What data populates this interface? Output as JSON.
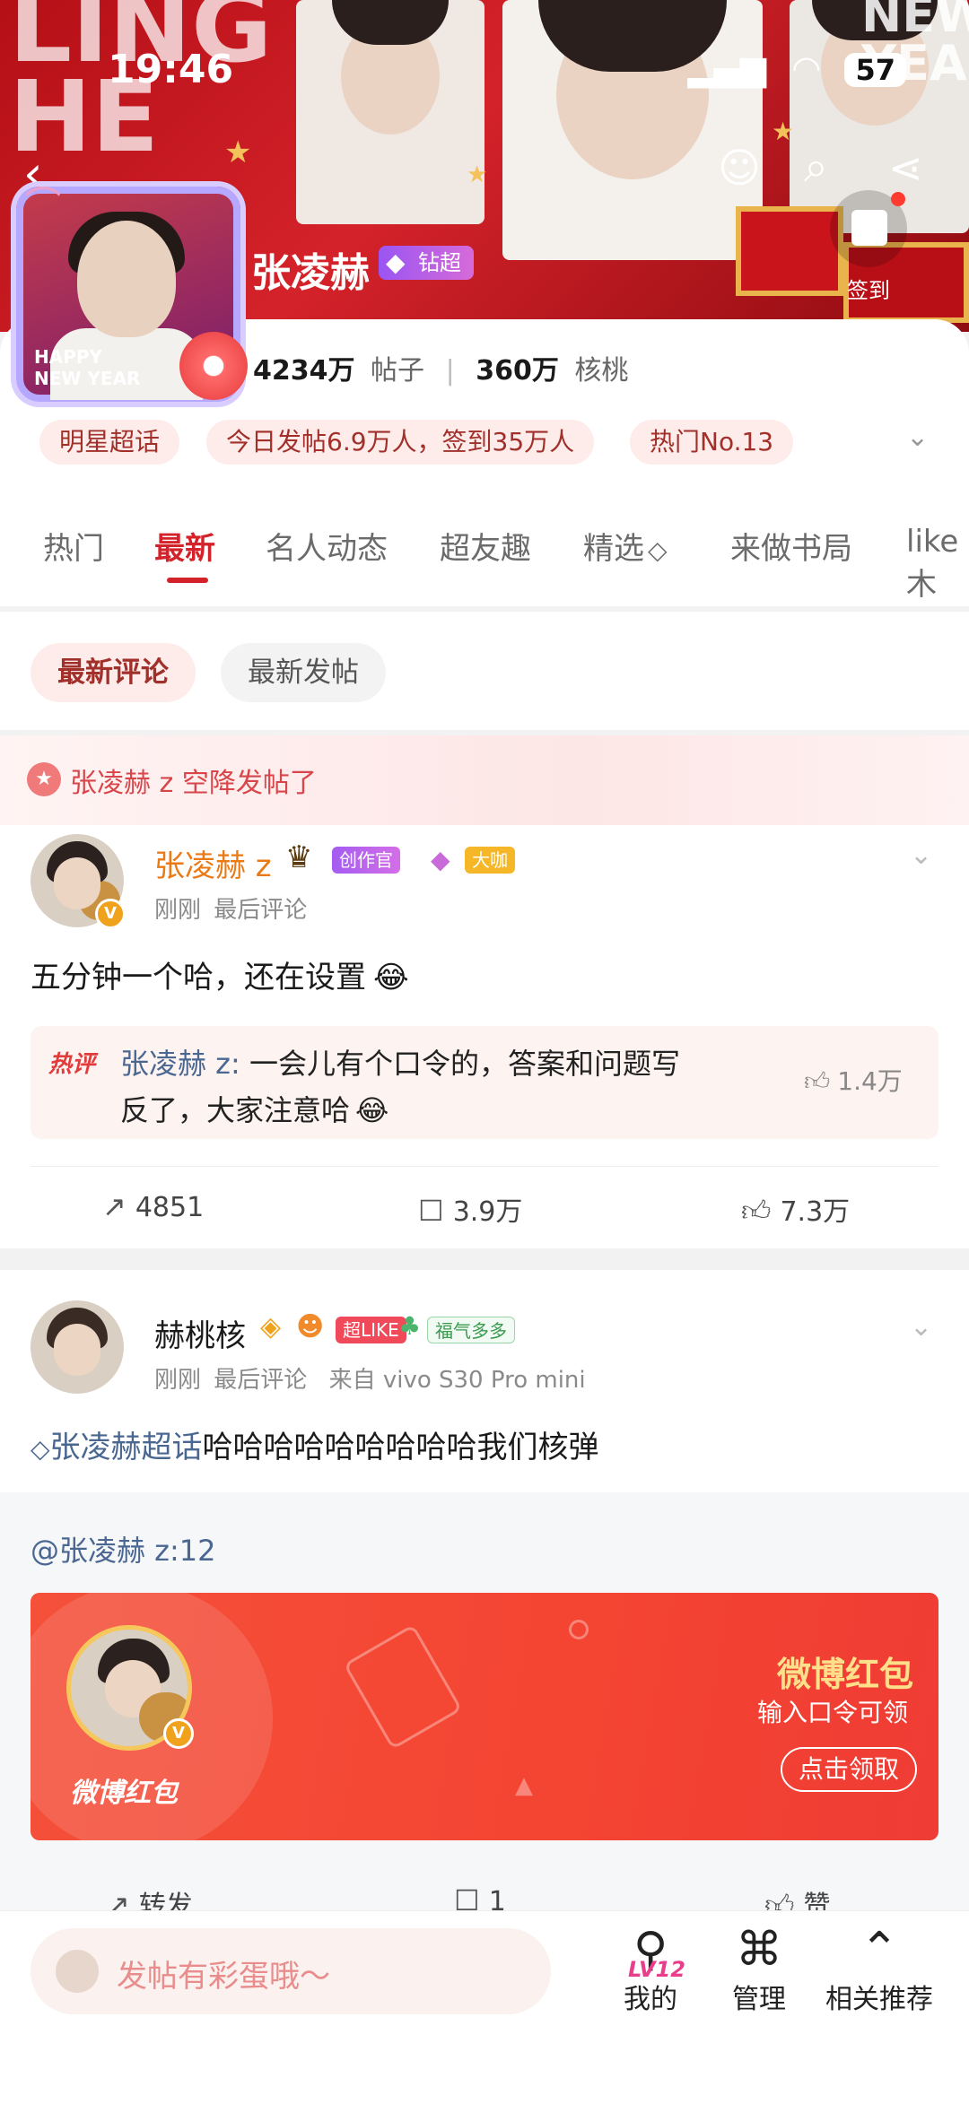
{
  "status_bar": {
    "time": "19:46",
    "battery": "57"
  },
  "header": {
    "topic_name": "张凌赫",
    "level_badge": "钻超",
    "checkin_label": "签到",
    "posts_count": "4234万",
    "posts_label": "帖子",
    "fans_count": "360万",
    "fans_label": "核桃",
    "chips": [
      "明星超话",
      "今日发帖6.9万人，签到35万人",
      "热门No.13"
    ]
  },
  "tabs": [
    "热门",
    "最新",
    "名人动态",
    "超友趣",
    "精选",
    "来做书局",
    "like木"
  ],
  "active_tab": "最新",
  "sort_pills": [
    "最新评论",
    "最新发帖"
  ],
  "post1": {
    "airdrop": "张凌赫 z 空降发帖了",
    "author": "张凌赫 z",
    "badges": [
      "创作官",
      "大咖"
    ],
    "time": "刚刚",
    "sub": "最后评论",
    "text": "五分钟一个哈，还在设置",
    "hot_label": "热评",
    "hot_comment_author": "张凌赫 z:",
    "hot_comment_line1": "一会儿有个口令的，答案和问题写",
    "hot_comment_line2": "反了，大家注意哈",
    "hot_comment_likes": "1.4万",
    "reposts": "4851",
    "comments": "3.9万",
    "likes": "7.3万"
  },
  "post2": {
    "author": "赫桃核",
    "badges": [
      "超LIKE",
      "福气多多"
    ],
    "time": "刚刚",
    "sub": "最后评论",
    "source": "来自 vivo S30 Pro mini",
    "topic_link": "张凌赫超话",
    "text": "哈哈哈哈哈哈哈哈哈我们核弹",
    "mention": "@张凌赫 z:12",
    "packet_logo": "微博红包",
    "packet_title": "微博红包",
    "packet_sub": "输入口令可领",
    "packet_button": "点击领取",
    "repost_label": "转发",
    "comment_count": "1",
    "like_label": "赞"
  },
  "bottom": {
    "compose_placeholder": "发帖有彩蛋哦～",
    "nav": [
      {
        "label": "我的",
        "sub": "LV12"
      },
      {
        "label": "管理"
      },
      {
        "label": "相关推荐"
      }
    ]
  },
  "colors": {
    "accent": "#d4222a",
    "brand_orange": "#e97a16",
    "link": "#4a6791",
    "packet": "#f4503a"
  }
}
